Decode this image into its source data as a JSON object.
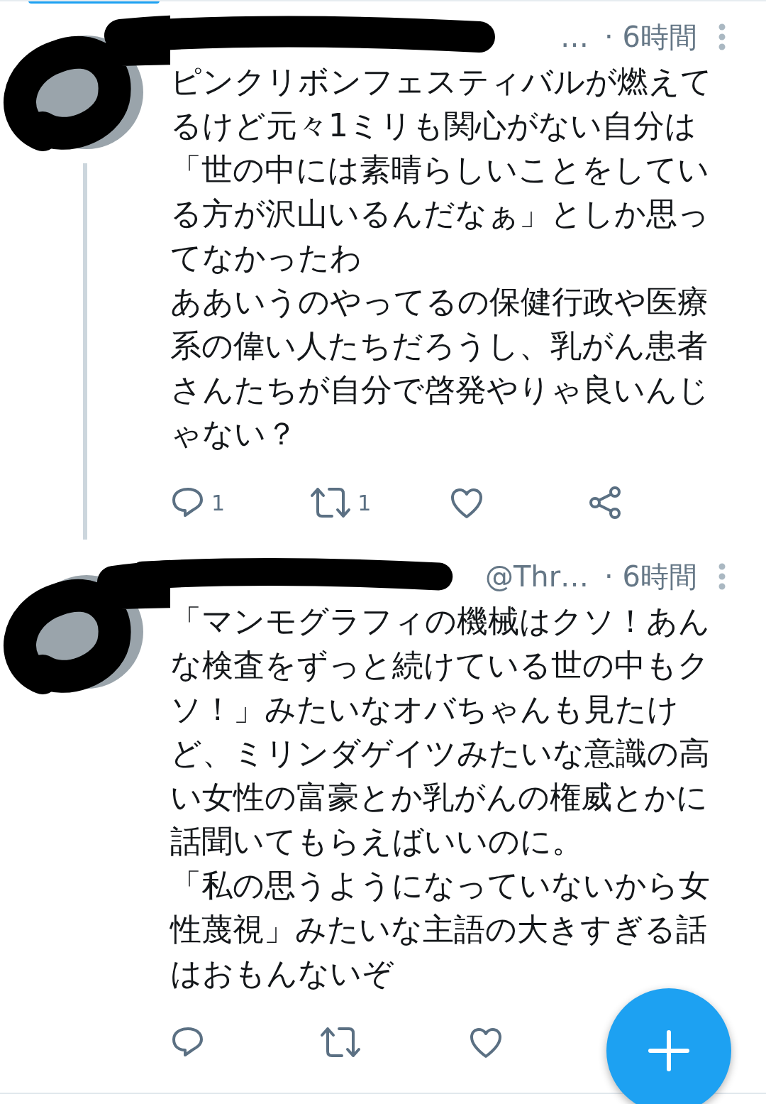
{
  "tweets": [
    {
      "handle": "…",
      "time": "· 6時間",
      "thread": true,
      "paragraphs": [
        "ピンクリボンフェスティバルが燃えてるけど元々1ミリも関心がない自分は「世の中には素晴らしいことをしている方が沢山いるんだなぁ」としか思ってなかったわ",
        "ああいうのやってるの保健行政や医療系の偉い人たちだろうし、乳がん患者さんたちが自分で啓発やりゃ良いんじゃない？"
      ],
      "actions": [
        {
          "kind": "reply",
          "count": "1"
        },
        {
          "kind": "retweet",
          "count": "1"
        },
        {
          "kind": "like"
        },
        {
          "kind": "share"
        }
      ]
    },
    {
      "handle": "@Thr…",
      "time": "· 6時間",
      "thread": false,
      "paragraphs": [
        "「マンモグラフィの機械はクソ！あんな検査をずっと続けている世の中もクソ！」みたいなオバちゃんも見たけど、ミリンダゲイツみたいな意識の高い女性の富豪とか乳がんの権威とかに話聞いてもらえばいいのに。",
        "「私の思うようになっていないから女性蔑視」みたいな主語の大きすぎる話はおもんないぞ"
      ],
      "actions": [
        {
          "kind": "reply"
        },
        {
          "kind": "retweet"
        },
        {
          "kind": "like"
        }
      ]
    }
  ]
}
